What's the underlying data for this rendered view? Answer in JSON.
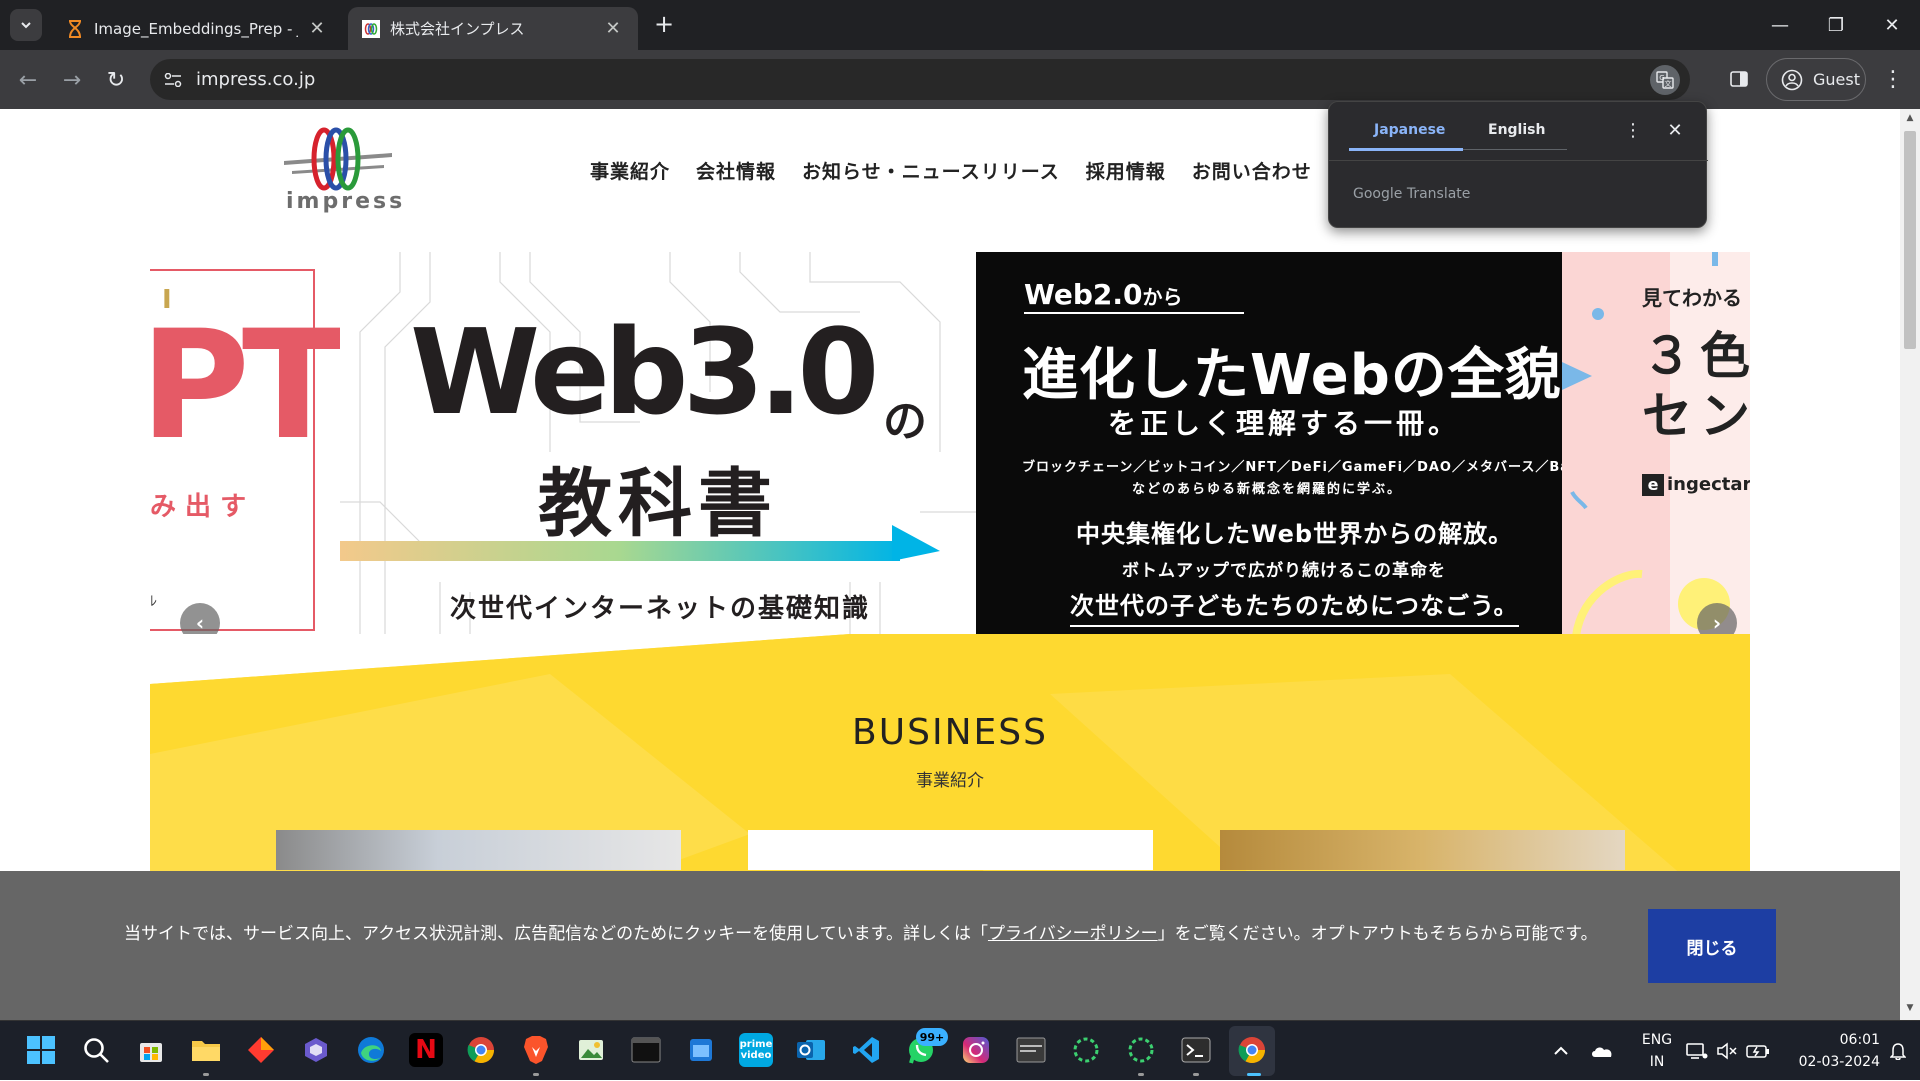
{
  "browser": {
    "tabs": [
      {
        "title": "Image_Embeddings_Prep - Jupy",
        "active": false
      },
      {
        "title": "株式会社インプレス",
        "active": true
      }
    ],
    "url": "impress.co.jp",
    "profile_label": "Guest"
  },
  "translate_popup": {
    "tab_source": "Japanese",
    "tab_target": "English",
    "brand": "Google Translate"
  },
  "site": {
    "logo_text": "impress",
    "nav": [
      "事業紹介",
      "会社情報",
      "お知らせ・ニュースリリース",
      "採用情報",
      "お問い合わせ"
    ]
  },
  "slider": {
    "left_slide": {
      "top": "I",
      "big": "PT",
      "small": "み 出 す",
      "mark": "ﾚ"
    },
    "main_slide": {
      "title": "Web3.0",
      "title_suffix": "の",
      "subtitle": "教科書",
      "tagline": "次世代インターネットの基礎知識"
    },
    "black_slide": {
      "line1": "Web2.0",
      "line1_suffix": "から",
      "line2": "進化したWebの全貌",
      "line3": "を正しく理解する一冊。",
      "line4": "ブロックチェーン／ビットコイン／NFT／DeFi／GameFi／DAO／メタバース／BaaS",
      "line5": "などのあらゆる新概念を網羅的に学ぶ。",
      "line6": "中央集権化したWeb世界からの解放。",
      "line7": "ボトムアップで広がり続けるこの革命を",
      "line8": "次世代の子どもたちのためにつなごう。"
    },
    "pink_slide": {
      "line1": "見てわかる",
      "line2": "３色",
      "line3": "セン",
      "publisher": "ingectar"
    }
  },
  "business": {
    "heading": "BUSINESS",
    "subheading": "事業紹介"
  },
  "cookie": {
    "text_before": "当サイトでは、サービス向上、アクセス状況計測、広告配信などのためにクッキーを使用しています。詳しくは「",
    "link": "プライバシーポリシー",
    "text_after": "」をご覧ください。オプトアウトもそちらから可能です。",
    "close_label": "閉じる"
  },
  "taskbar": {
    "whatsapp_badge": "99+",
    "lang_line1": "ENG",
    "lang_line2": "IN",
    "time": "06:01",
    "date": "02-03-2024"
  },
  "colors": {
    "accent_red": "#e55a66",
    "business_yellow": "#fed930",
    "cookie_button": "#1d3ea3",
    "translate_active": "#8ab4f8"
  }
}
